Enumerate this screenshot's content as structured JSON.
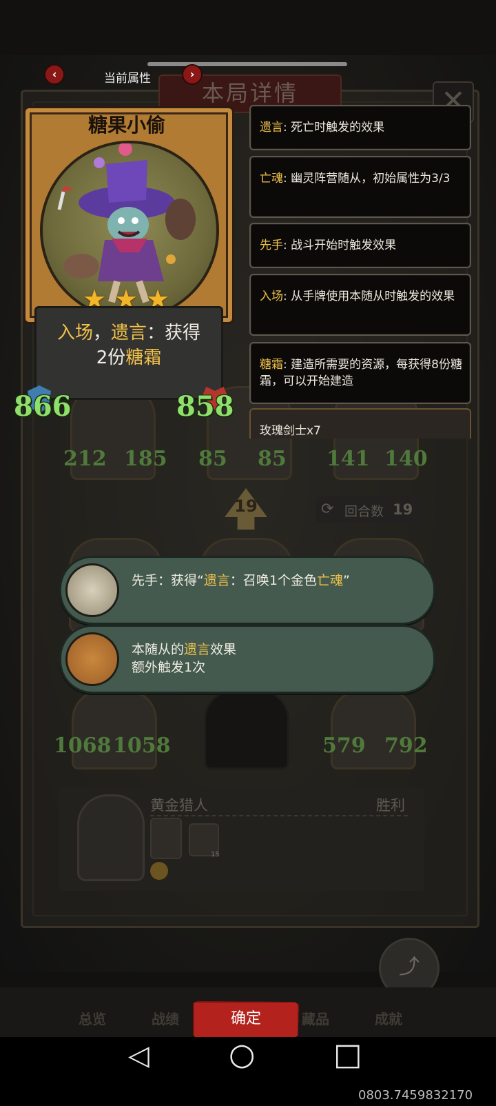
{
  "screen": {
    "page_label": "当前属性",
    "dialog_title": "本局详情",
    "close_glyph": "✕",
    "prev_arrow": "‹",
    "next_arrow": "›"
  },
  "card": {
    "name": "糖果小偷",
    "star_count": 3,
    "star_glyph": "★",
    "description": {
      "kw1": "入场",
      "sep1": "，",
      "kw2": "遗言",
      "mid": "：获得",
      "line2_pre": "2份",
      "kw3": "糖霜"
    },
    "attack": "866",
    "health": "858"
  },
  "tooltips": [
    {
      "keyword": "遗言",
      "text": ": 死亡时触发的效果"
    },
    {
      "keyword": "亡魂",
      "text": ": 幽灵阵营随从，初始属性为3/3"
    },
    {
      "keyword": "先手",
      "text": ": 战斗开始时触发效果"
    },
    {
      "keyword": "入场",
      "text": ": 从手牌使用本随从时触发的效果"
    },
    {
      "keyword": "糖霜",
      "text": ": 建造所需要的资源，每获得8份糖霜，可以开始建造"
    }
  ],
  "partial_tooltip": "玫瑰剑士x7",
  "board": {
    "row1": [
      {
        "atk": "212",
        "hp": "185"
      },
      {
        "atk": "85",
        "hp": "85"
      },
      {
        "atk": "141",
        "hp": "140"
      }
    ],
    "row3": [
      {
        "atk": "1068",
        "hp": "1058"
      },
      {
        "atk": "579",
        "hp": "792"
      }
    ],
    "turn_number": "19",
    "round_label": "回合数",
    "round_value": "19",
    "round_icon": "⟳"
  },
  "bubbles": [
    {
      "pre": "先手：获得“",
      "kw1": "遗言",
      "mid": "：召唤1个金色",
      "kw2": "亡魂",
      "post": "”"
    },
    {
      "pre": "本随从的",
      "kw1": "遗言",
      "mid": "效果",
      "line2": "额外触发1次"
    }
  ],
  "player": {
    "name": "黄金猎人",
    "result": "胜利",
    "mini_count": "15"
  },
  "share": {
    "label": "分享",
    "icon": "share-icon"
  },
  "bottom_tabs": [
    "总览",
    "战绩",
    "藏品",
    "成就"
  ],
  "confirm_label": "确定",
  "sys_nav": {
    "back": "◁",
    "home": "○",
    "recent": "□"
  },
  "build_id": "0803.7459832170",
  "colors": {
    "keyword": "#f1c24a",
    "stat_green": "#8ee06a",
    "confirm_red": "#b4221e",
    "bubble": "#445a4f"
  }
}
